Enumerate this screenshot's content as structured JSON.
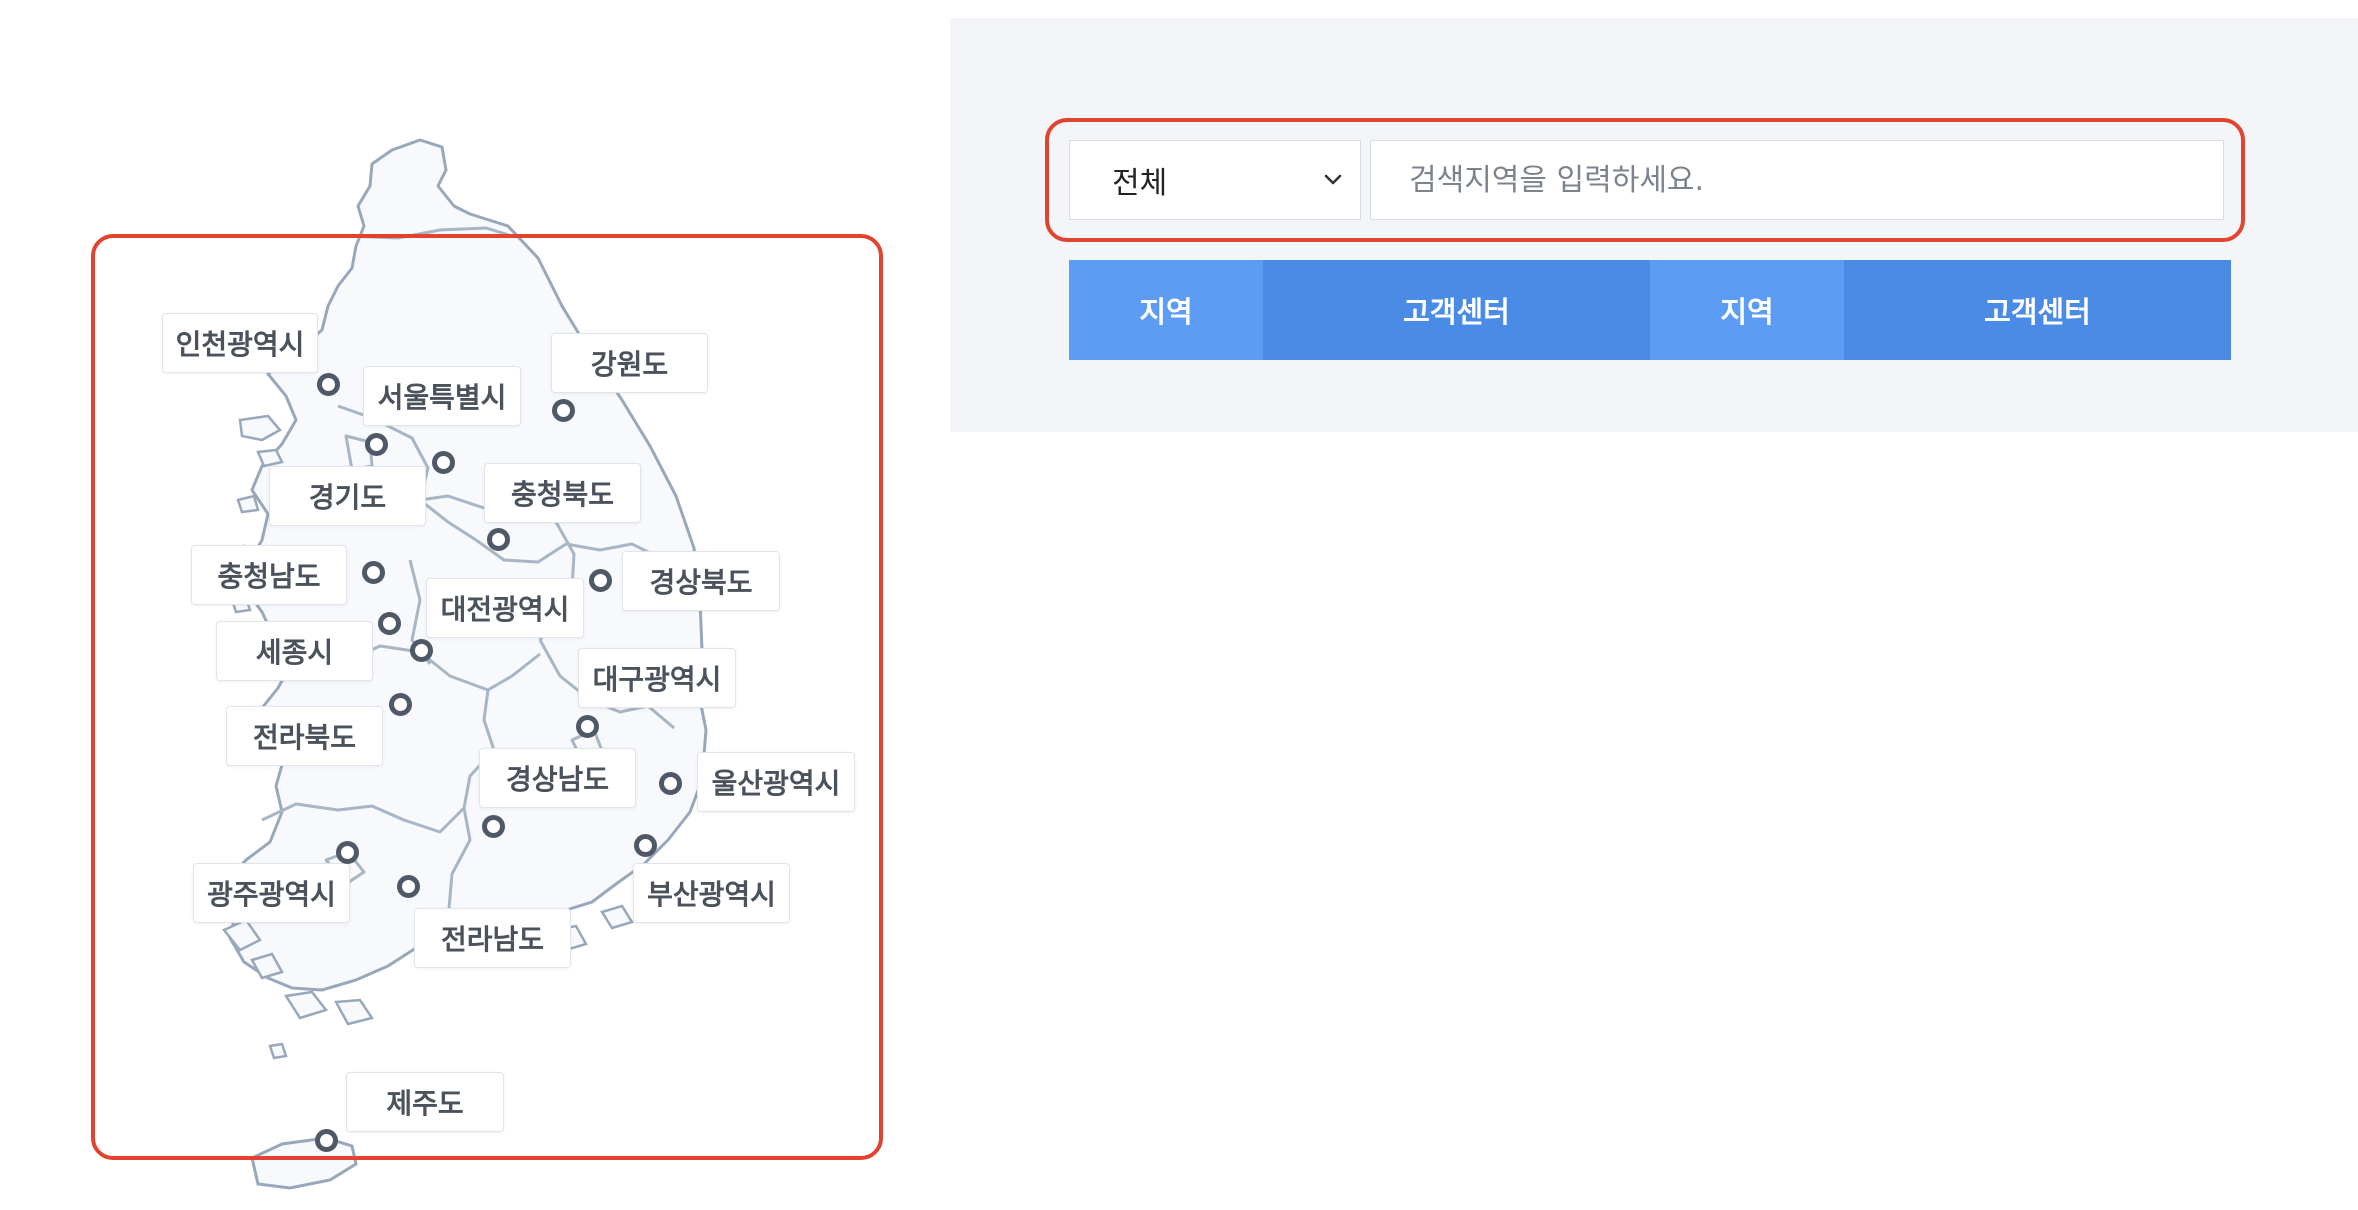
{
  "map": {
    "regions": [
      {
        "key": "incheon",
        "label": "인천광역시"
      },
      {
        "key": "seoul",
        "label": "서울특별시"
      },
      {
        "key": "gangwon",
        "label": "강원도"
      },
      {
        "key": "gyeonggi",
        "label": "경기도"
      },
      {
        "key": "chungbuk",
        "label": "충청북도"
      },
      {
        "key": "chungnam",
        "label": "충청남도"
      },
      {
        "key": "daejeon",
        "label": "대전광역시"
      },
      {
        "key": "gyeongbuk",
        "label": "경상북도"
      },
      {
        "key": "sejong",
        "label": "세종시"
      },
      {
        "key": "daegu",
        "label": "대구광역시"
      },
      {
        "key": "jeonbuk",
        "label": "전라북도"
      },
      {
        "key": "gyeongnam",
        "label": "경상남도"
      },
      {
        "key": "ulsan",
        "label": "울산광역시"
      },
      {
        "key": "gwangju",
        "label": "광주광역시"
      },
      {
        "key": "busan",
        "label": "부산광역시"
      },
      {
        "key": "jeonnam",
        "label": "전라남도"
      },
      {
        "key": "jeju",
        "label": "제주도"
      }
    ]
  },
  "search": {
    "select_value": "전체",
    "placeholder": "검색지역을 입력하세요."
  },
  "table": {
    "headers": [
      "지역",
      "고객센터",
      "지역",
      "고객센터"
    ]
  },
  "colors": {
    "highlight": "#e2432e",
    "header_region": "#5d9cf4",
    "header_center": "#4a8be6",
    "panel_bg": "#f3f5f8"
  }
}
